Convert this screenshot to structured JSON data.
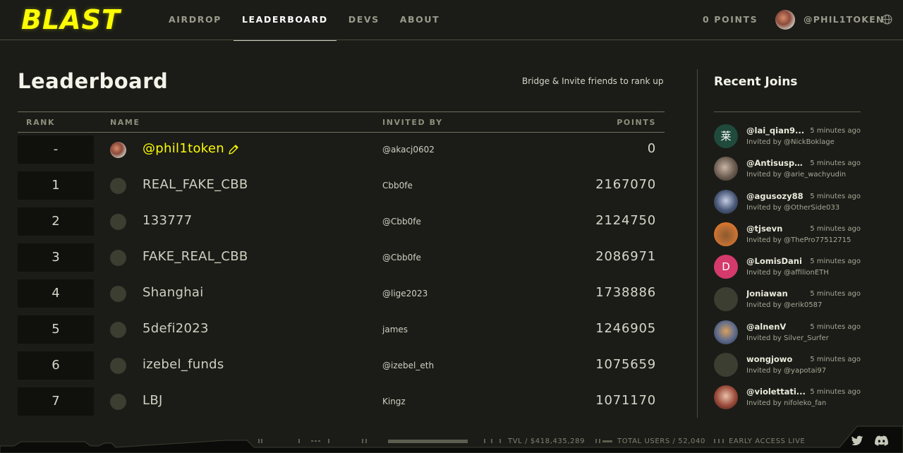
{
  "header": {
    "logo": "BLAST",
    "nav": [
      "AIRDROP",
      "LEADERBOARD",
      "DEVS",
      "ABOUT"
    ],
    "points": "0 POINTS",
    "user": "@PHIL1TOKEN"
  },
  "leaderboard": {
    "title": "Leaderboard",
    "hint": "Bridge & Invite friends to rank up",
    "columns": {
      "rank": "RANK",
      "name": "NAME",
      "invited_by": "INVITED BY",
      "points": "POINTS"
    },
    "rows": [
      {
        "rank": "-",
        "name": "@phil1token",
        "invited_by": "@akacj0602",
        "points": "0"
      },
      {
        "rank": "1",
        "name": "REAL_FAKE_CBB",
        "invited_by": "Cbb0fe",
        "points": "2167070"
      },
      {
        "rank": "2",
        "name": "133777",
        "invited_by": "@Cbb0fe",
        "points": "2124750"
      },
      {
        "rank": "3",
        "name": "FAKE_REAL_CBB",
        "invited_by": "@Cbb0fe",
        "points": "2086971"
      },
      {
        "rank": "4",
        "name": "Shanghai",
        "invited_by": "@lige2023",
        "points": "1738886"
      },
      {
        "rank": "5",
        "name": "5defi2023",
        "invited_by": "james",
        "points": "1246905"
      },
      {
        "rank": "6",
        "name": "izebel_funds",
        "invited_by": "@izebel_eth",
        "points": "1075659"
      },
      {
        "rank": "7",
        "name": "LBJ",
        "invited_by": "Kingz",
        "points": "1071170"
      }
    ]
  },
  "recent_joins": {
    "title": "Recent Joins",
    "items": [
      {
        "name": "@lai_qian9...",
        "time": "5 minutes ago",
        "invited": "Invited by @NickBoklage",
        "avatar_text": "莱",
        "avatar_color": "#1f4a3c"
      },
      {
        "name": "@Antisuspe...",
        "time": "5 minutes ago",
        "invited": "Invited by @arie_wachyudin",
        "avatar_text": "",
        "avatar_color": "#6a5a4f"
      },
      {
        "name": "@agusozy88",
        "time": "5 minutes ago",
        "invited": "Invited by @OtherSide033",
        "avatar_text": "",
        "avatar_color": "#4a5878"
      },
      {
        "name": "@tjsevn",
        "time": "5 minutes ago",
        "invited": "Invited by @ThePro77512715",
        "avatar_text": "",
        "avatar_color": "#d8752c"
      },
      {
        "name": "@LomisDani",
        "time": "5 minutes ago",
        "invited": "Invited by @affilionETH",
        "avatar_text": "D",
        "avatar_color": "#d43a6c"
      },
      {
        "name": "Joniawan",
        "time": "5 minutes ago",
        "invited": "Invited by @erik0587",
        "avatar_text": "",
        "avatar_color": "#3b3e31"
      },
      {
        "name": "@alnenV",
        "time": "5 minutes ago",
        "invited": "Invited by Silver_Surfer",
        "avatar_text": "",
        "avatar_color": "#5c6a8a"
      },
      {
        "name": "wongjowo",
        "time": "5 minutes ago",
        "invited": "Invited by @yapotai97",
        "avatar_text": "",
        "avatar_color": "#3b3e31"
      },
      {
        "name": "@violettati...",
        "time": "5 minutes ago",
        "invited": "Invited by nifoleko_fan",
        "avatar_text": "",
        "avatar_color": "#9a4a3a"
      }
    ]
  },
  "footer": {
    "tvl": "TVL / $418,435,289",
    "total_users": "TOTAL USERS / 52,040",
    "status": "EARLY ACCESS LIVE"
  },
  "colors": {
    "accent": "#fcfc03",
    "background": "#1b1c17",
    "rank_cell": "#10110d"
  },
  "icons": [
    "globe-icon",
    "pencil-icon",
    "twitter-icon",
    "discord-icon"
  ]
}
